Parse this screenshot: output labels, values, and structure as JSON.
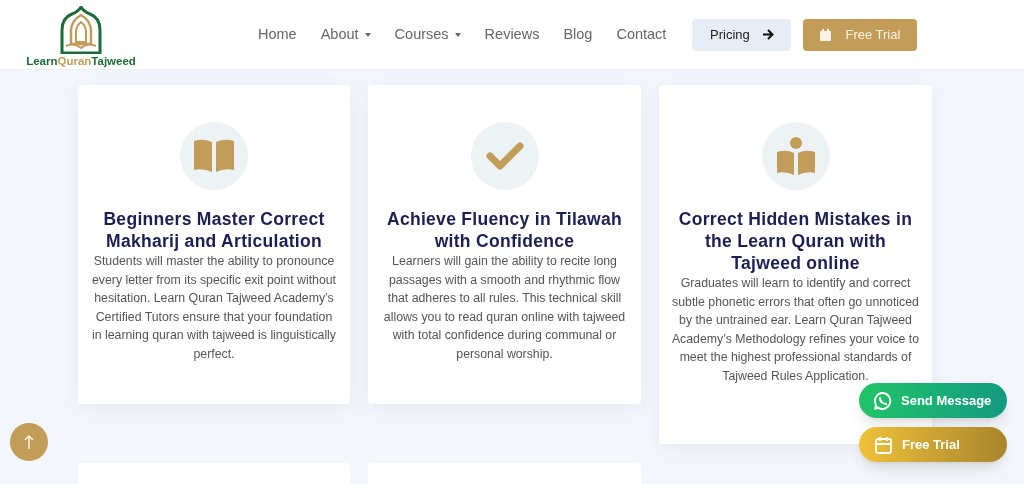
{
  "logo": {
    "words": [
      "Learn",
      "Quran",
      "Tajweed"
    ]
  },
  "nav": [
    {
      "label": "Home",
      "dropdown": false
    },
    {
      "label": "About",
      "dropdown": true
    },
    {
      "label": "Courses",
      "dropdown": true
    },
    {
      "label": "Reviews",
      "dropdown": false
    },
    {
      "label": "Blog",
      "dropdown": false
    },
    {
      "label": "Contact",
      "dropdown": false
    }
  ],
  "pricing_button": "Pricing",
  "trial_button": "Free Trial",
  "cards": [
    {
      "kind": "book",
      "title": "Beginners Master Correct Makharij and Articulation",
      "text": "Students will master the ability to pronounce every letter from its specific exit point without hesitation. Learn Quran Tajweed Academy’s Certified Tutors ensure that your foundation in learning quran with tajweed is linguistically perfect."
    },
    {
      "kind": "check",
      "title": "Achieve Fluency in Tilawah with Confidence",
      "text": "Learners will gain the ability to recite long passages with a smooth and rhythmic flow that adheres to all rules. This technical skill allows you to read quran online with tajweed with total confidence during communal or personal worship."
    },
    {
      "kind": "reader",
      "title": "Correct Hidden Mistakes in the Learn Quran with Tajweed online",
      "text": "Graduates will learn to identify and correct subtle phonetic errors that often go unnoticed by the untrained ear. Learn Quran Tajweed Academy’s Methodology refines your voice to meet the highest professional standards of Tajweed Rules Application."
    }
  ],
  "floating": {
    "message": "Send Message",
    "trial": "Free Trial"
  }
}
